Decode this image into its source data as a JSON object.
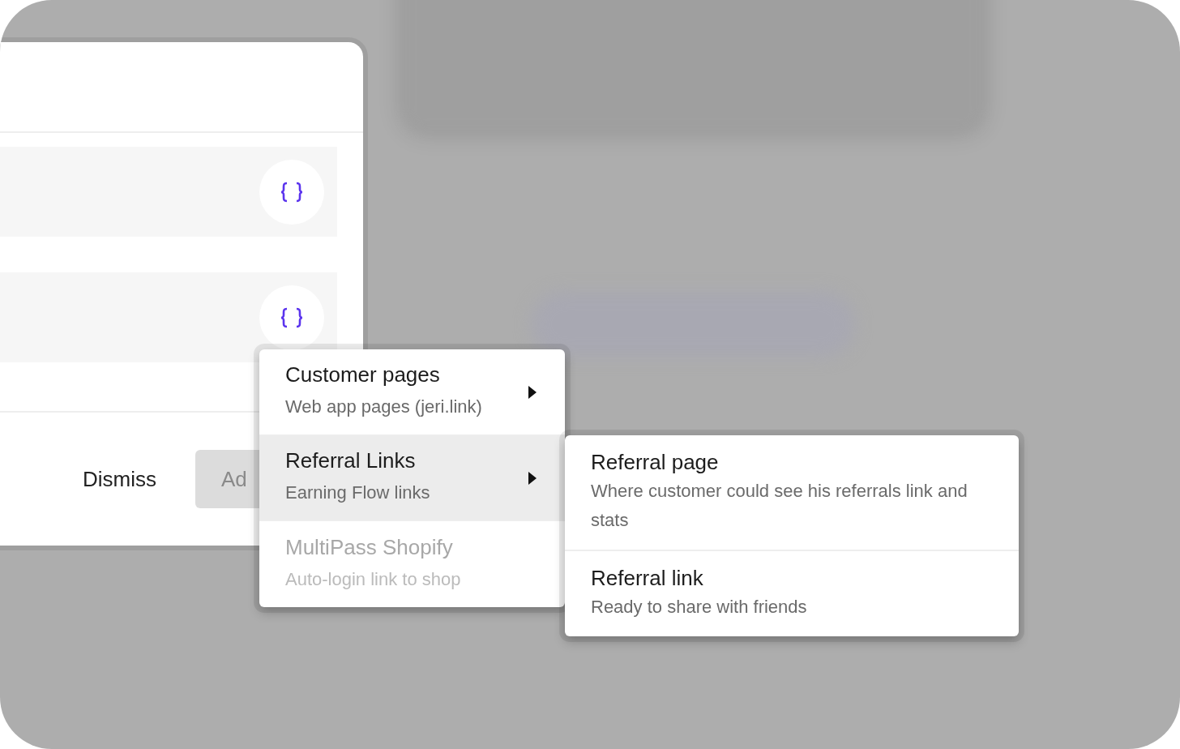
{
  "dialog": {
    "buttons": [
      {
        "label": "Dismiss",
        "kind": "text"
      },
      {
        "label": "Ad",
        "kind": "filled"
      }
    ]
  },
  "menu": {
    "items": [
      {
        "title": "Customer pages",
        "subtitle": "Web app pages (jeri.link)",
        "has_submenu": true,
        "disabled": false,
        "selected": false
      },
      {
        "title": "Referral Links",
        "subtitle": "Earning Flow links",
        "has_submenu": true,
        "disabled": false,
        "selected": true
      },
      {
        "title": "MultiPass Shopify",
        "subtitle": "Auto-login link to shop",
        "has_submenu": false,
        "disabled": true,
        "selected": false
      }
    ]
  },
  "submenu": {
    "items": [
      {
        "title": "Referral page",
        "subtitle": "Where customer could see his referrals link and stats"
      },
      {
        "title": "Referral link",
        "subtitle": "Ready to share with friends"
      }
    ]
  }
}
